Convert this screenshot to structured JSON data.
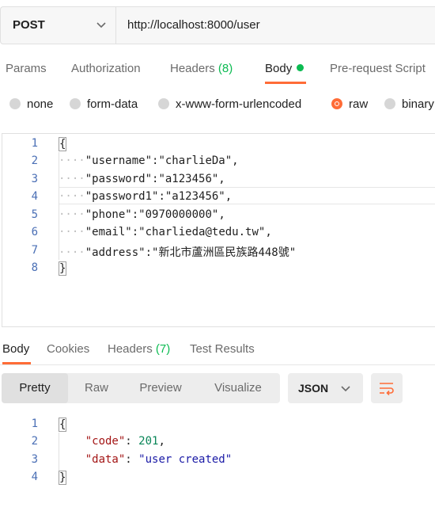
{
  "request": {
    "method": "POST",
    "url": "http://localhost:8000/user"
  },
  "request_tabs": {
    "params": "Params",
    "authorization": "Authorization",
    "headers": "Headers",
    "headers_count": "(8)",
    "body": "Body",
    "prerequest": "Pre-request Script"
  },
  "body_types": {
    "none": "none",
    "form_data": "form-data",
    "urlencoded": "x-www-form-urlencoded",
    "raw": "raw",
    "binary": "binary",
    "selected": "raw"
  },
  "request_body": {
    "line_numbers": [
      "1",
      "2",
      "3",
      "4",
      "5",
      "6",
      "7",
      "8"
    ],
    "open_brace": "{",
    "close_brace": "}",
    "indent_dots": "····",
    "fields": [
      {
        "key": "\"username\"",
        "value": "\"charlieDa\","
      },
      {
        "key": "\"password\"",
        "value": "\"a123456\","
      },
      {
        "key": "\"password1\"",
        "value": "\"a123456\","
      },
      {
        "key": "\"phone\"",
        "value": "\"0970000000\","
      },
      {
        "key": "\"email\"",
        "value": "\"charlieda@tedu.tw\","
      },
      {
        "key": "\"address\"",
        "value": "\"新北市蘆洲區民族路448號\""
      }
    ]
  },
  "response_tabs": {
    "body": "Body",
    "cookies": "Cookies",
    "headers": "Headers",
    "headers_count": "(7)",
    "test_results": "Test Results"
  },
  "view_modes": {
    "pretty": "Pretty",
    "raw": "Raw",
    "preview": "Preview",
    "visualize": "Visualize",
    "format": "JSON"
  },
  "response_body": {
    "line_numbers": [
      "1",
      "2",
      "3",
      "4"
    ],
    "open_brace": "{",
    "close_brace": "}",
    "code_key": "\"code\"",
    "code_value": "201",
    "data_key": "\"data\"",
    "data_value": "\"user created\""
  },
  "colors": {
    "accent": "#ff6c37",
    "count_green": "#0cbb52"
  }
}
